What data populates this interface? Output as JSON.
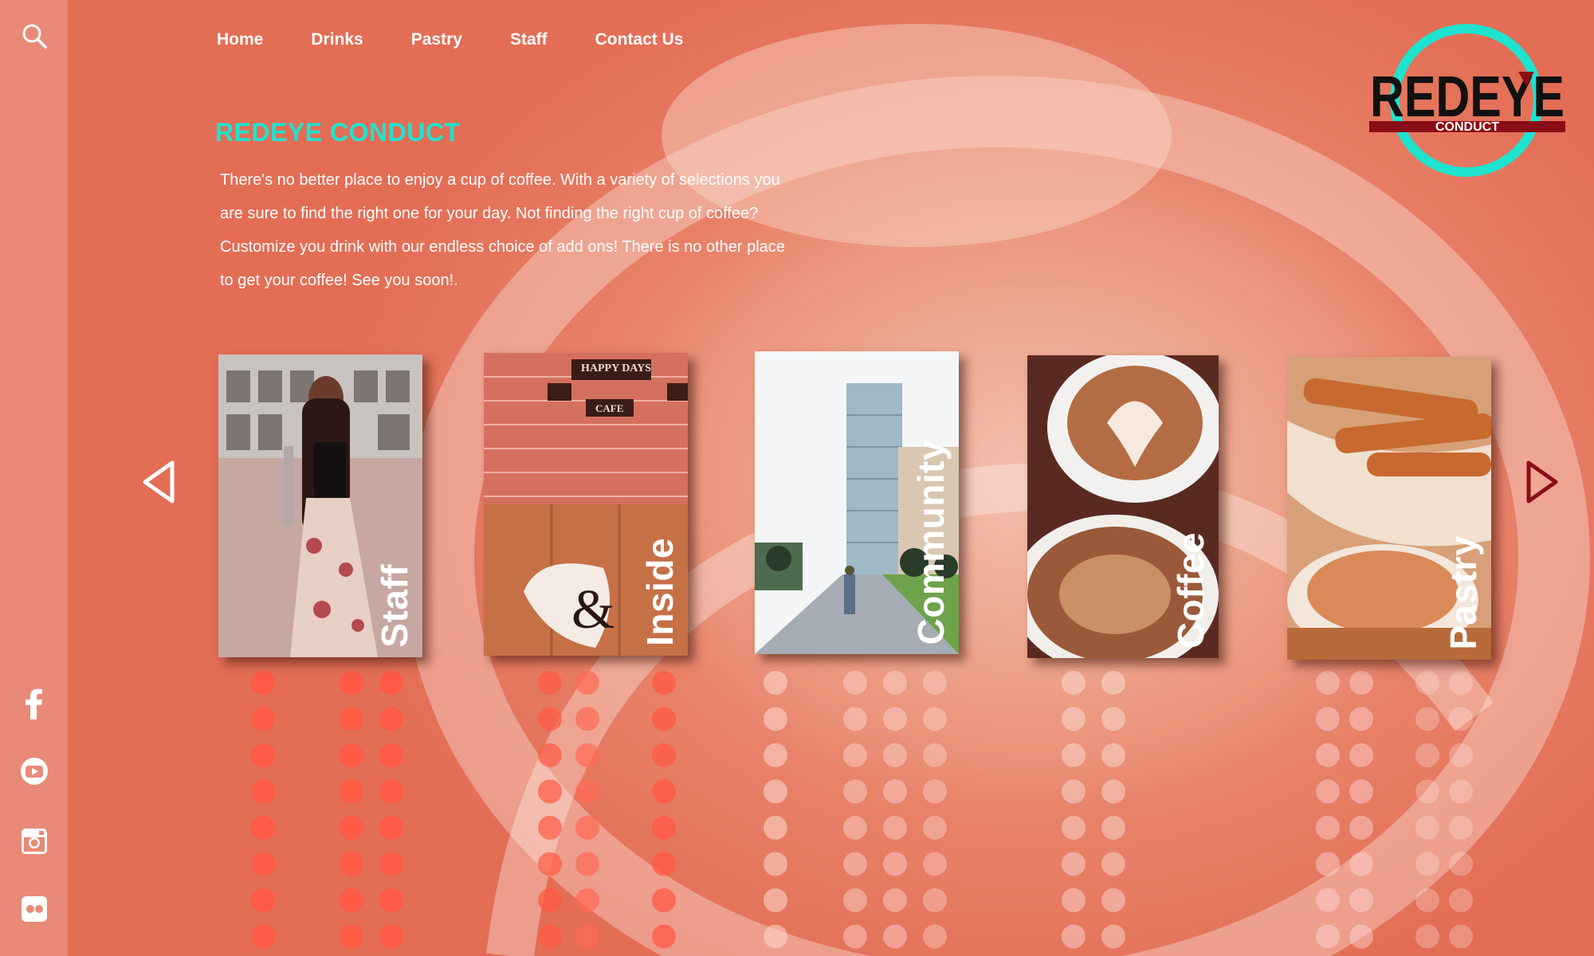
{
  "nav": {
    "items": [
      {
        "label": "Home"
      },
      {
        "label": "Drinks"
      },
      {
        "label": "Pastry"
      },
      {
        "label": "Staff"
      },
      {
        "label": "Contact Us"
      }
    ]
  },
  "hero": {
    "title": "REDEYE CONDUCT",
    "intro": "There's no better place to enjoy a cup of coffee. With a variety of selections you are sure to find the right one for your day. Not finding the right cup of coffee? Customize you drink with our endless choice of add ons! There is no other place to get your coffee! See you soon!."
  },
  "logo": {
    "name": "REDEYE",
    "sub": "CONDUCT",
    "ring_color": "#1ee3cf",
    "bar_color": "#8b0d16"
  },
  "carousel": {
    "cards": [
      {
        "label": "Staff"
      },
      {
        "label": "Inside"
      },
      {
        "label": "Community"
      },
      {
        "label": "Coffee"
      },
      {
        "label": "Pastry"
      }
    ]
  },
  "sign": {
    "line1": "HAPPY DAYS",
    "line2": "CAFE"
  },
  "colors": {
    "accent": "#1ee3cf",
    "arrow_left": "#ffffff",
    "arrow_right": "#8b0d16"
  },
  "icons": {
    "sidebar": [
      "search-icon",
      "facebook-icon",
      "youtube-icon",
      "instagram-icon",
      "flickr-icon"
    ],
    "carousel": [
      "prev-arrow-icon",
      "next-arrow-icon"
    ]
  }
}
